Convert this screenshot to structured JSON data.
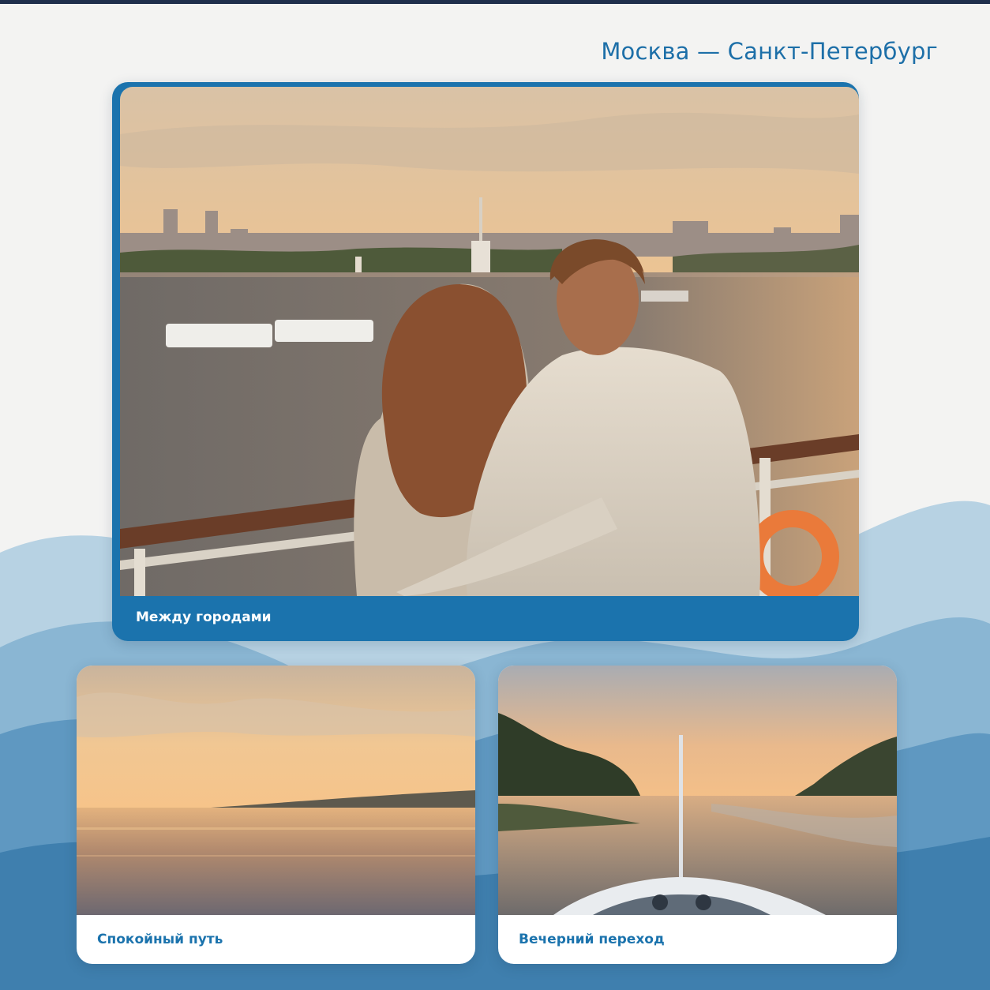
{
  "header": {
    "route": "Москва — Санкт-Петербург"
  },
  "cards": {
    "hero": {
      "caption": "Между городами",
      "image": "couple-on-ship-deck-photo"
    },
    "left": {
      "caption": "Спокойный путь",
      "image": "river-sunset-photo"
    },
    "right": {
      "caption": "Вечерний переход",
      "image": "ship-bow-river-photo"
    }
  },
  "colors": {
    "accent": "#1b73ad",
    "title": "#1d6fa8",
    "background": "#f3f3f2",
    "wave_light": "#aac9dd",
    "wave_mid": "#6fa6c8",
    "wave_dark": "#3d7fae"
  }
}
